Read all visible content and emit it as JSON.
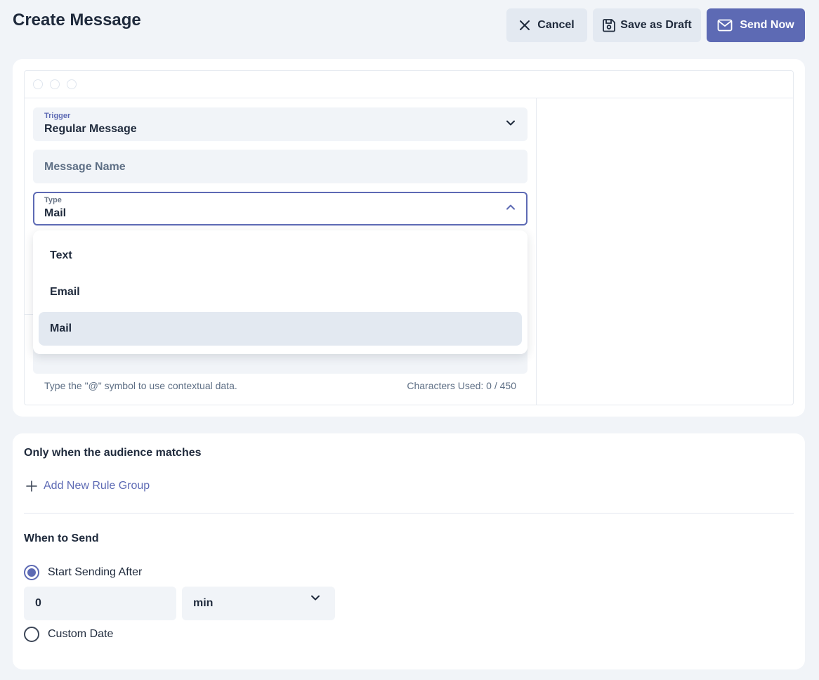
{
  "header": {
    "title": "Create Message",
    "cancel_label": "Cancel",
    "draft_label": "Save as Draft",
    "send_label": "Send Now"
  },
  "form": {
    "trigger": {
      "label": "Trigger",
      "value": "Regular Message"
    },
    "message_name": {
      "placeholder": "Message Name"
    },
    "type": {
      "label": "Type",
      "value": "Mail",
      "options": [
        "Text",
        "Email",
        "Mail"
      ],
      "selected": "Mail"
    },
    "helper_text": "Type the \"@\" symbol to use contextual data.",
    "chars_used": "Characters Used: 0 / 450"
  },
  "audience": {
    "title": "Only when the audience matches",
    "add_rule_label": "Add New Rule Group"
  },
  "schedule": {
    "title": "When to Send",
    "option_after": "Start Sending After",
    "after_value": "0",
    "after_unit": "min",
    "option_custom": "Custom Date",
    "selected": "Start Sending After"
  },
  "colors": {
    "accent": "#5d6ab4",
    "background": "#f1f4f8",
    "surface": "#ffffff",
    "text": "#1f2a3c"
  },
  "icons": [
    "close-icon",
    "save-icon",
    "mail-icon",
    "chevron-down-icon",
    "chevron-up-icon",
    "plus-icon"
  ]
}
